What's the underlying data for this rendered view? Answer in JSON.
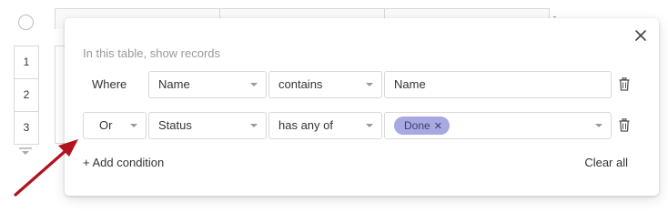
{
  "table": {
    "row_numbers": [
      "1",
      "2",
      "3"
    ]
  },
  "filter_popup": {
    "heading": "In this table, show records",
    "close_icon": "close-icon",
    "conditions": [
      {
        "conjunction": "Where",
        "field": "Name",
        "operator": "contains",
        "value": "Name"
      },
      {
        "conjunction": "Or",
        "field": "Status",
        "operator": "has any of",
        "tags": [
          {
            "label": "Done",
            "remove_glyph": "✕",
            "color": "#a8a9e3"
          }
        ]
      }
    ],
    "add_condition_label": "+ Add condition",
    "clear_all_label": "Clear all",
    "trash_icon": "trash-icon"
  },
  "annotation": {
    "arrow_color": "#b2111f"
  }
}
